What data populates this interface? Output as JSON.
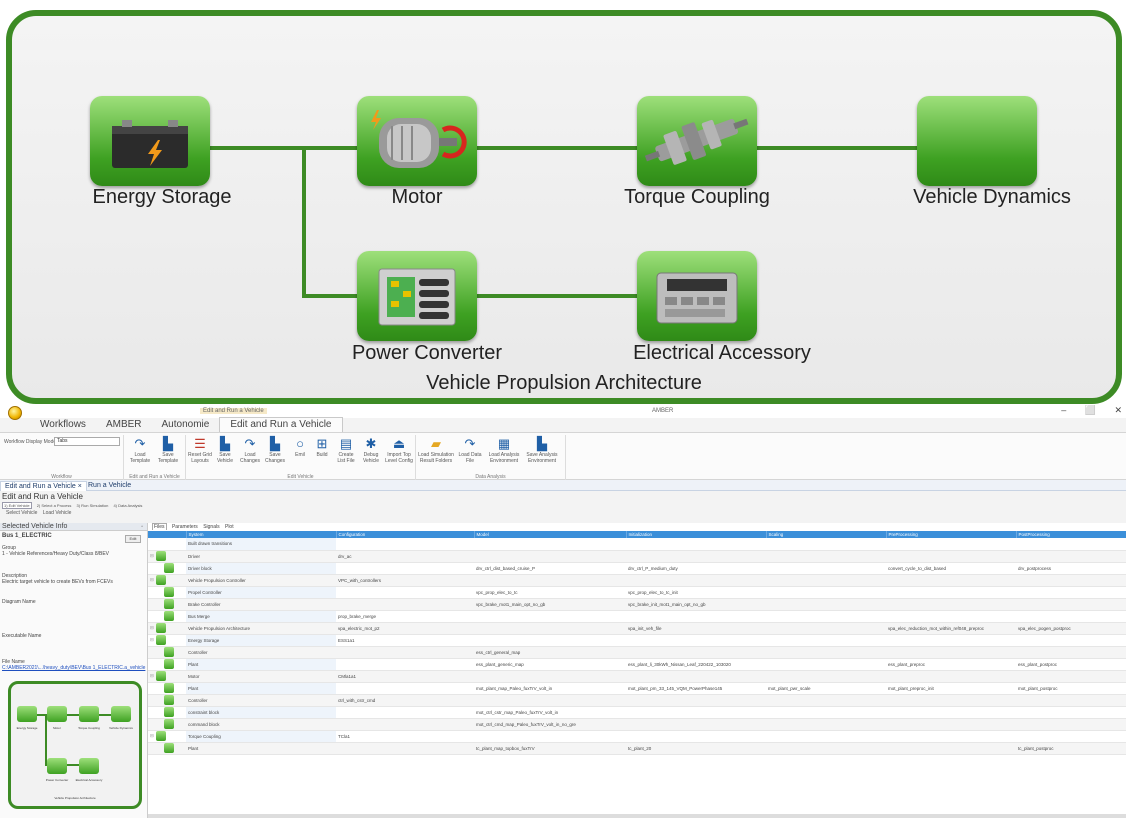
{
  "diagram": {
    "title": "Vehicle Propulsion Architecture",
    "nodes": {
      "energy_storage": "Energy Storage",
      "motor": "Motor",
      "torque_coupling": "Torque Coupling",
      "vehicle_dynamics": "Vehicle Dynamics",
      "power_converter": "Power Converter",
      "electrical_accessory": "Electrical Accessory"
    }
  },
  "window": {
    "context_tab": "Edit and Run a Vehicle",
    "title": "AMBER",
    "buttons": [
      "–",
      "⬜",
      "✕"
    ]
  },
  "menu_tabs": [
    "Workflows",
    "AMBER",
    "Autonomie",
    "Edit and Run a Vehicle"
  ],
  "ribbon": {
    "workflow_display_mode_label": "Workflow Display Mode",
    "workflow_display_mode_value": "Tabs",
    "group_workflow": "Workflow",
    "group_template": "Edit and Run a Vehicle",
    "load_template": "Load Template",
    "save_template": "Save Template",
    "group_edit_vehicle": "Edit Vehicle",
    "edit_buttons": [
      "Reset Grid Layouts",
      "Save Vehicle",
      "Load Changes",
      "Save Changes",
      "Emil",
      "Build",
      "Create List File",
      "Debug Vehicle",
      "Import Top Level Config"
    ],
    "group_data_analysis": "Data Analysis",
    "data_buttons": [
      "Load Simulation Result Folders",
      "Load Data File",
      "Load Analysis Environment",
      "Save Analysis Environment"
    ]
  },
  "doc_tabs": [
    "Edit and Run a Vehicle",
    "Run a Vehicle"
  ],
  "page_title": "Edit and Run a Vehicle",
  "steps": [
    "1) Edit Vehicle",
    "2) Select a Process",
    "3) Run Simulation",
    "4) Data Analysis"
  ],
  "sub_toolbar": [
    "Select Vehicle",
    "Load Vehicle"
  ],
  "left_panel": {
    "header": "Selected Vehicle Info",
    "vehicle_name": "Bus 1_ELECTRIC",
    "group_label": "Group",
    "group_value": "1 - Vehicle References/Heavy Duty/Class 8/BEV",
    "edit_label": "Edit",
    "description_label": "Description",
    "description_value": "Electric target vehicle to create BEVs from FCEVs",
    "diagram_name_label": "Diagram Name",
    "executable_name_label": "Executable Name",
    "file_name_label": "File Name",
    "file_name_value": "C:\\AMBER2021\\...\\heavy_duty\\BEV\\Bus 1_ELECTRIC.a_vehicle",
    "mini_labels": [
      "Energy Storage",
      "Motor",
      "Torque Coupling",
      "Vehicle Dynamics",
      "Power Converter",
      "Electrical Accessory",
      "Vehicle Propulsion Architecture"
    ]
  },
  "grid": {
    "tabs": [
      "Files",
      "Parameters",
      "Signals",
      "Plot"
    ],
    "headers": [
      "",
      "System",
      "Configuration",
      "Model",
      "Initialization",
      "Scaling",
      "PreProcessing",
      "PostProcessing"
    ],
    "rows": [
      {
        "system": "Built drawn transitions",
        "config": "",
        "model": "",
        "init": "",
        "scaling": "",
        "pre": "",
        "post": ""
      },
      {
        "system": "Driver",
        "config": "drv_ac",
        "model": "",
        "init": "",
        "scaling": "",
        "pre": "",
        "post": ""
      },
      {
        "system": "Driver block",
        "config": "",
        "model": "drv_ctrl_dist_based_cruise_P",
        "init": "drv_ctrl_P_medium_duty",
        "scaling": "",
        "pre": "convert_cycle_to_dist_based",
        "post": "drv_postprocess"
      },
      {
        "system": "Vehicle Propulsion Controller",
        "config": "VPC_with_controllers",
        "model": "",
        "init": "",
        "scaling": "",
        "pre": "",
        "post": ""
      },
      {
        "system": "Propel Controller",
        "config": "",
        "model": "vpc_prop_elec_to_tc",
        "init": "vpc_prop_elec_to_tc_init",
        "scaling": "",
        "pre": "",
        "post": ""
      },
      {
        "system": "Brake Controller",
        "config": "",
        "model": "vpc_brake_mot1_main_opt_no_gb",
        "init": "vpc_brake_init_mot1_main_opt_no_gb",
        "scaling": "",
        "pre": "",
        "post": ""
      },
      {
        "system": "Bus Merge",
        "config": "prop_brake_merge",
        "model": "",
        "init": "",
        "scaling": "",
        "pre": "",
        "post": ""
      },
      {
        "system": "Vehicle Propulsion Architecture",
        "config": "vpa_electric_mot_p2",
        "model": "",
        "init": "vpa_init_veh_file",
        "scaling": "",
        "pre": "vpa_elec_reduction_mot_within_ref048_preproc",
        "post": "vpa_elec_pogen_postproc"
      },
      {
        "system": "Energy Storage",
        "config": "ESS1a1",
        "model": "",
        "init": "",
        "scaling": "",
        "pre": "",
        "post": ""
      },
      {
        "system": "Controller",
        "config": "",
        "model": "ess_ctrl_general_map",
        "init": "",
        "scaling": "",
        "pre": "",
        "post": ""
      },
      {
        "system": "Plant",
        "config": "",
        "model": "ess_plant_generic_map",
        "init": "ess_plant_li_30kWh_Nissan_Leaf_220422_103020",
        "scaling": "",
        "pre": "ess_plant_preproc",
        "post": "ess_plant_postproc"
      },
      {
        "system": "Motor",
        "config": "CMla1a1",
        "model": "",
        "init": "",
        "scaling": "",
        "pre": "",
        "post": ""
      },
      {
        "system": "Plant",
        "config": "",
        "model": "mot_plant_map_Paleo_fuxTrV_volt_in",
        "init": "mot_plant_pm_33_145_VQM_PowerPhase145",
        "scaling": "mot_plant_pwr_scale",
        "pre": "mot_plant_preproc_init",
        "post": "mot_plant_postproc"
      },
      {
        "system": "Controller",
        "config": "ctrl_with_cstr_cmd",
        "model": "",
        "init": "",
        "scaling": "",
        "pre": "",
        "post": ""
      },
      {
        "system": "constraint block",
        "config": "",
        "model": "mot_ctrl_cstr_map_Paleo_fuxTrV_volt_in",
        "init": "",
        "scaling": "",
        "pre": "",
        "post": ""
      },
      {
        "system": "command block",
        "config": "",
        "model": "mot_ctrl_cmd_map_Paleo_fuxTrV_volt_in_no_gre",
        "init": "",
        "scaling": "",
        "pre": "",
        "post": ""
      },
      {
        "system": "Torque Coupling",
        "config": "TCla1",
        "model": "",
        "init": "",
        "scaling": "",
        "pre": "",
        "post": ""
      },
      {
        "system": "Plant",
        "config": "",
        "model": "tc_plant_map_topbox_fuxTrV",
        "init": "tc_plant_20",
        "scaling": "",
        "pre": "",
        "post": "tc_plant_postproc"
      }
    ]
  },
  "colors": {
    "accent_green": "#3d8b25",
    "grid_header_blue": "#3b8fd9"
  }
}
